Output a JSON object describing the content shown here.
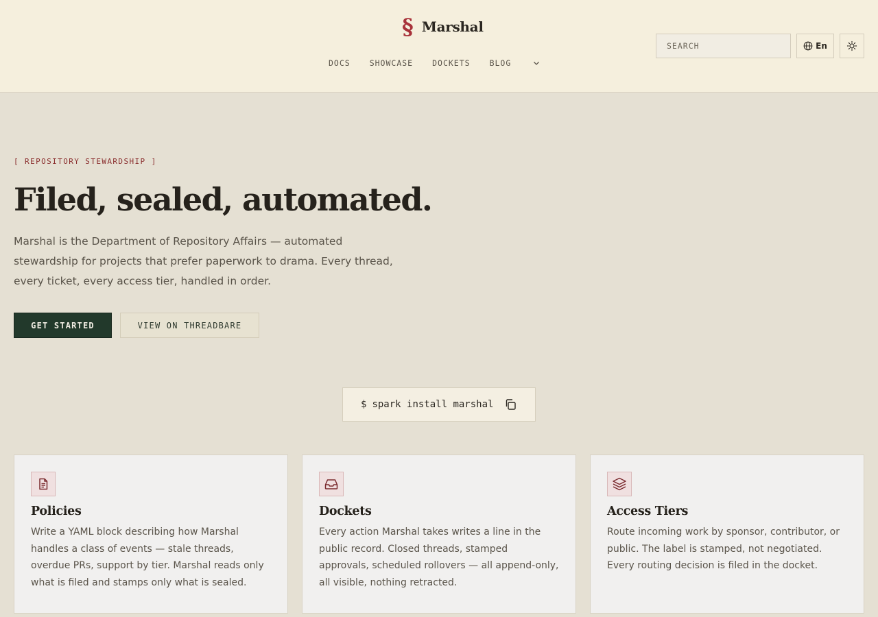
{
  "brand": {
    "mark": "§",
    "name": "Marshal"
  },
  "nav": {
    "items": [
      {
        "label": "DOCS"
      },
      {
        "label": "SHOWCASE"
      },
      {
        "label": "DOCKETS"
      },
      {
        "label": "BLOG"
      }
    ],
    "more_icon": "chevron-down-icon"
  },
  "search": {
    "placeholder": "SEARCH",
    "value": ""
  },
  "language": {
    "icon": "globe-icon",
    "label": "En"
  },
  "theme_toggle": {
    "icon": "sun-icon"
  },
  "hero": {
    "eyebrow": "[ REPOSITORY STEWARDSHIP ]",
    "title": "Filed, sealed, automated.",
    "lead": "Marshal is the Department of Repository Affairs — automated stewardship for projects that prefer paperwork to drama. Every thread, every ticket, every access tier, handled in order.",
    "primary_label": "GET STARTED",
    "secondary_label": "VIEW ON THREADBARE"
  },
  "install": {
    "prompt": "$",
    "command": "spark install marshal",
    "copy_icon": "copy-icon"
  },
  "features": [
    {
      "icon": "document-icon",
      "title": "Policies",
      "description": "Write a YAML block describing how Marshal handles a class of events — stale threads, overdue PRs, support by tier. Marshal reads only what is filed and stamps only what is sealed."
    },
    {
      "icon": "inbox-icon",
      "title": "Dockets",
      "description": "Every action Marshal takes writes a line in the public record. Closed threads, stamped approvals, scheduled rollovers — all append-only, all visible, nothing retracted."
    },
    {
      "icon": "layers-icon",
      "title": "Access Tiers",
      "description": "Route incoming work by sponsor, contributor, or public. The label is stamped, not negotiated. Every routing decision is filed in the docket."
    }
  ],
  "colors": {
    "accent": "#a8323a",
    "primary_button": "#22392b",
    "header_bg": "#f5efdd",
    "page_bg": "#e5e0d3"
  }
}
